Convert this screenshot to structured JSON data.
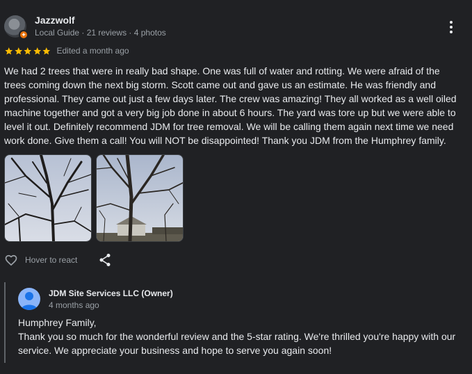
{
  "review": {
    "author": {
      "name": "Jazzwolf",
      "meta": "Local Guide · 21 reviews · 4 photos",
      "badge_icon": "local-guide-badge-icon"
    },
    "rating": {
      "stars": 5,
      "max": 5,
      "star_color": "#fbbc04"
    },
    "edited": "Edited a month ago",
    "text": "We had 2 trees that were in really bad shape. One was full of water and rotting. We were afraid of the trees coming down the next big storm. Scott came out and gave us an estimate. He was friendly and professional. They came out just a few days later. The crew was amazing! They all worked as a well oiled machine together and got a very big job done in about 6 hours. The yard was tore up but we were able to level it out. Definitely recommend JDM for tree removal. We will be calling them again next time we need work done. Give them a call! You will NOT be disappointed! Thank you JDM from the Humphrey family.",
    "photos_count": 2,
    "react_label": "Hover to react",
    "icons": [
      "more-options-icon",
      "heart-icon",
      "share-icon"
    ]
  },
  "owner_reply": {
    "name": "JDM Site Services LLC (Owner)",
    "date": "4 months ago",
    "greeting": "Humphrey Family,",
    "body": "Thank you so much for the wonderful review and the 5-star rating. We're thrilled you're happy with our service. We appreciate your business and hope to serve you again soon!",
    "avatar_color": "#8ab4f8"
  }
}
